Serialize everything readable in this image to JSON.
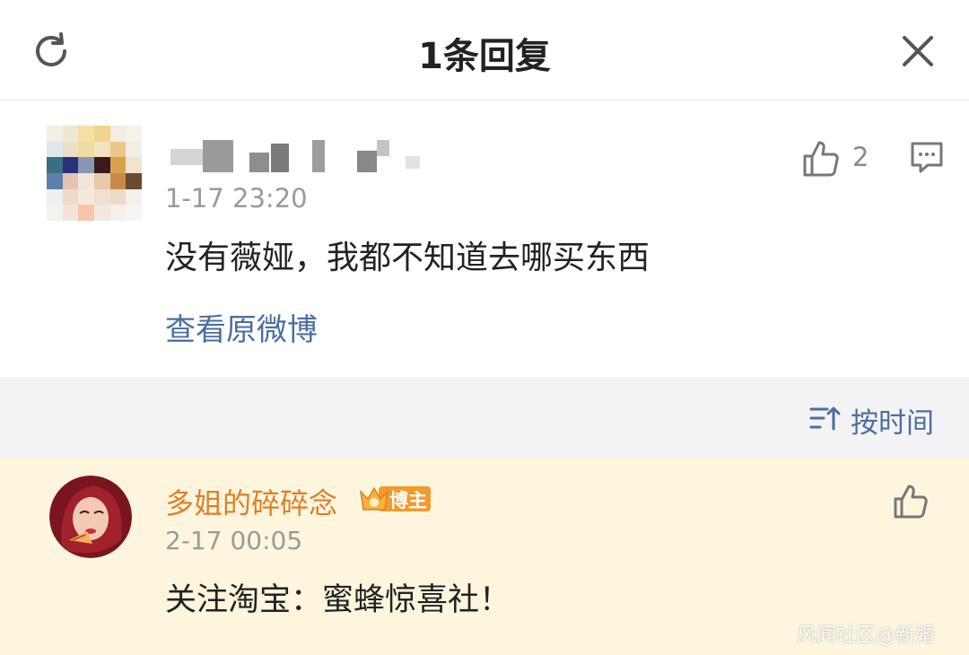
{
  "header": {
    "title": "1条回复"
  },
  "post": {
    "timestamp": "1-17 23:20",
    "text": "没有薇娅，我都不知道去哪买东西",
    "view_original_label": "查看原微博",
    "like_count": "2"
  },
  "sort": {
    "label": "按时间"
  },
  "reply": {
    "username": "多姐的碎碎念",
    "badge_label": "博主",
    "timestamp": "2-17 00:05",
    "text": "关注淘宝：蜜蜂惊喜社！"
  },
  "watermark": "风闻社区@新婚",
  "colors": {
    "link": "#4c6ea0",
    "reply_background": "#fdf6dd",
    "username_orange": "#e07e2a",
    "badge_orange": "#f29a2e"
  },
  "icons": {
    "refresh": "refresh-icon",
    "close": "close-icon",
    "like": "thumbs-up-icon",
    "comment": "comment-icon",
    "sort": "sort-icon",
    "badge": "crown-badge-icon"
  }
}
